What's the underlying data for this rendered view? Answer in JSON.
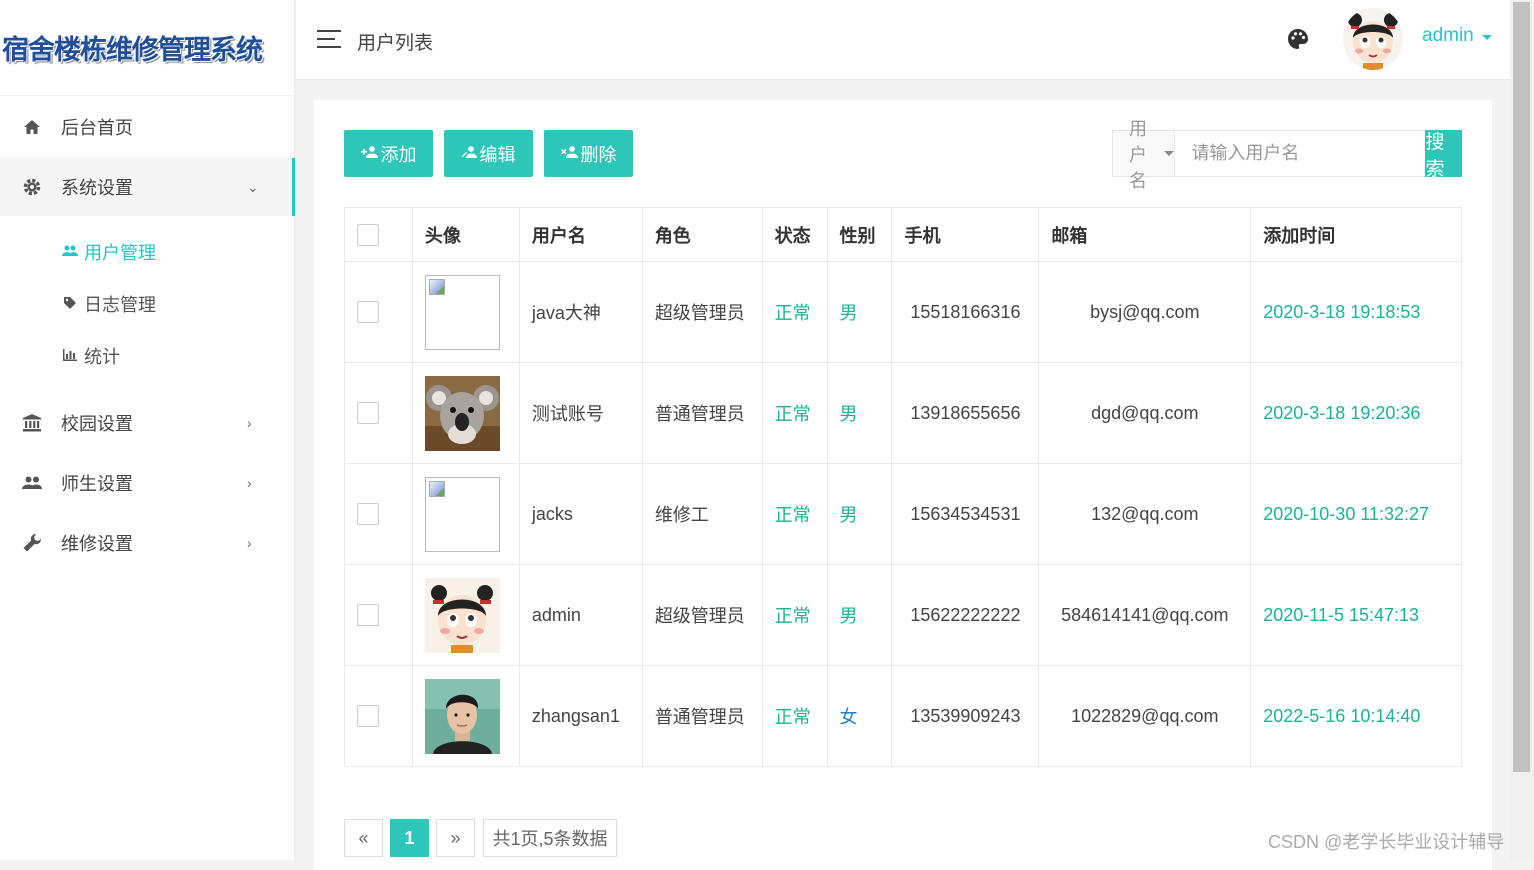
{
  "app": {
    "logo_text": "宿舍楼栋维修管理系统"
  },
  "sidebar": {
    "items": [
      {
        "label": "后台首页",
        "icon": "home-icon"
      },
      {
        "label": "系统设置",
        "icon": "gear-icon"
      },
      {
        "label": "校园设置",
        "icon": "bank-icon"
      },
      {
        "label": "师生设置",
        "icon": "users-icon"
      },
      {
        "label": "维修设置",
        "icon": "wrench-icon"
      }
    ],
    "sub_items": [
      {
        "label": "用户管理",
        "icon": "users-icon"
      },
      {
        "label": "日志管理",
        "icon": "tags-icon"
      },
      {
        "label": "统计",
        "icon": "bar-chart-icon"
      }
    ]
  },
  "header": {
    "page_title": "用户列表",
    "user_name": "admin"
  },
  "toolbar": {
    "add_label": "添加",
    "edit_label": "编辑",
    "delete_label": "删除"
  },
  "search": {
    "field_label": "用户名",
    "placeholder": "请输入用户名",
    "button_label": "搜索"
  },
  "table": {
    "headers": [
      "头像",
      "用户名",
      "角色",
      "状态",
      "性别",
      "手机",
      "邮箱",
      "添加时间"
    ],
    "rows": [
      {
        "avatar": "broken",
        "username": "java大神",
        "role": "超级管理员",
        "status": "正常",
        "gender": "男",
        "phone": "15518166316",
        "email": "bysj@qq.com",
        "added": "2020-3-18 19:18:53"
      },
      {
        "avatar": "koala",
        "username": "测试账号",
        "role": "普通管理员",
        "status": "正常",
        "gender": "男",
        "phone": "13918655656",
        "email": "dgd@qq.com",
        "added": "2020-3-18 19:20:36"
      },
      {
        "avatar": "broken",
        "username": "jacks",
        "role": "维修工",
        "status": "正常",
        "gender": "男",
        "phone": "15634534531",
        "email": "132@qq.com",
        "added": "2020-10-30 11:32:27"
      },
      {
        "avatar": "cartoon-girl",
        "username": "admin",
        "role": "超级管理员",
        "status": "正常",
        "gender": "男",
        "phone": "15622222222",
        "email": "584614141@qq.com",
        "added": "2020-11-5 15:47:13"
      },
      {
        "avatar": "young-man",
        "username": "zhangsan1",
        "role": "普通管理员",
        "status": "正常",
        "gender": "女",
        "phone": "13539909243",
        "email": "1022829@qq.com",
        "added": "2022-5-16 10:14:40"
      }
    ]
  },
  "pagination": {
    "prev": "«",
    "current": "1",
    "next": "»",
    "summary": "共1页,5条数据"
  },
  "watermark": "CSDN @老学长毕业设计辅导",
  "colors": {
    "accent": "#2fc6ba",
    "status_green": "#1ab394",
    "gender_female": "#1c84c6",
    "logo_blue": "#1f4e9a"
  }
}
